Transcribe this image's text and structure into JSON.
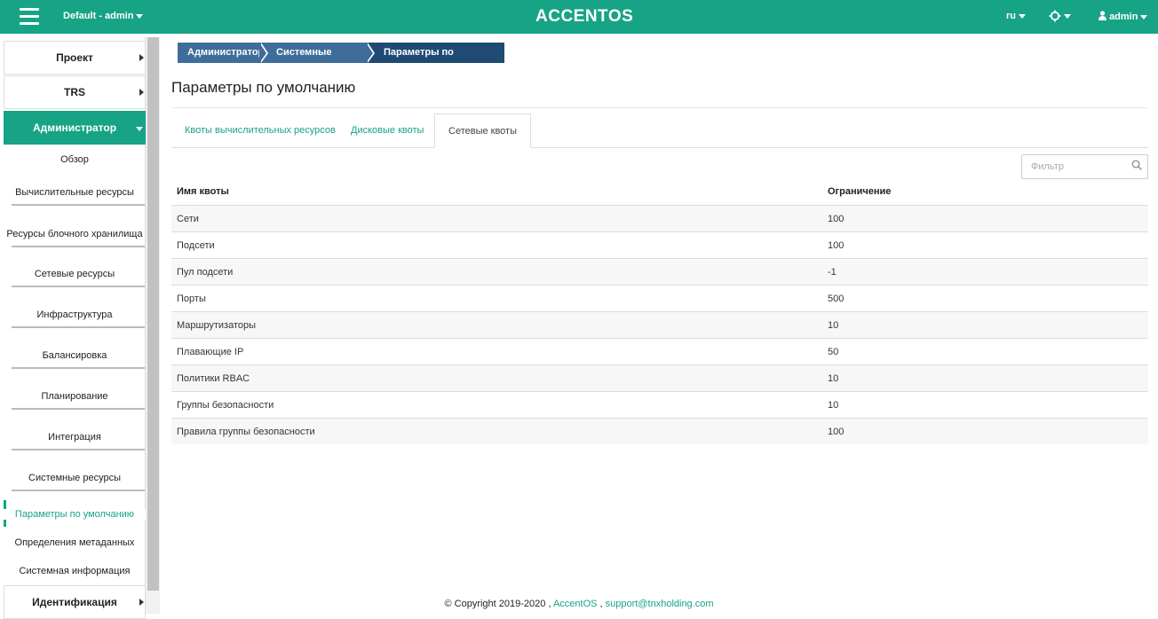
{
  "topbar": {
    "project": "Default - admin",
    "logo": "ACCENTOS",
    "language": "ru",
    "user": "admin"
  },
  "sidebar": {
    "sections": [
      {
        "label": "Проект"
      },
      {
        "label": "TRS"
      },
      {
        "label": "Администратор"
      },
      {
        "label": "Идентификация"
      }
    ],
    "admin_items": [
      {
        "label": "Обзор"
      },
      {
        "label": "Вычислительные ресурсы"
      },
      {
        "label": "Ресурсы блочного хранилища"
      },
      {
        "label": "Сетевые ресурсы"
      },
      {
        "label": "Инфраструктура"
      },
      {
        "label": "Балансировка"
      },
      {
        "label": "Планирование"
      },
      {
        "label": "Интеграция"
      },
      {
        "label": "Системные ресурсы"
      }
    ],
    "system_sub_items": [
      {
        "label": "Параметры по умолчанию"
      },
      {
        "label": "Определения метаданных"
      },
      {
        "label": "Системная информация"
      }
    ]
  },
  "breadcrumb": [
    "Администратор",
    "Системные ресурсы",
    "Параметры по умолчанию"
  ],
  "page_title": "Параметры по умолчанию",
  "tabs": [
    {
      "label": "Квоты вычислительных ресурсов"
    },
    {
      "label": "Дисковые квоты"
    },
    {
      "label": "Сетевые квоты"
    }
  ],
  "filter": {
    "placeholder": "Фильтр"
  },
  "table": {
    "headers": [
      "Имя квоты",
      "Ограничение"
    ],
    "rows": [
      [
        "Сети",
        "100"
      ],
      [
        "Подсети",
        "100"
      ],
      [
        "Пул подсети",
        "-1"
      ],
      [
        "Порты",
        "500"
      ],
      [
        "Маршрутизаторы",
        "10"
      ],
      [
        "Плавающие IP",
        "50"
      ],
      [
        "Политики RBAC",
        "10"
      ],
      [
        "Группы безопасности",
        "10"
      ],
      [
        "Правила группы безопасности",
        "100"
      ]
    ]
  },
  "footer": {
    "copyright": "© Copyright 2019-2020 ,",
    "brand": "AccentOS",
    "separator": ",",
    "email": "support@tnxholding.com"
  },
  "colors": {
    "accent": "#17a386",
    "breadcrumb": "#3f6d9a",
    "breadcrumb_active": "#1f4a73"
  }
}
